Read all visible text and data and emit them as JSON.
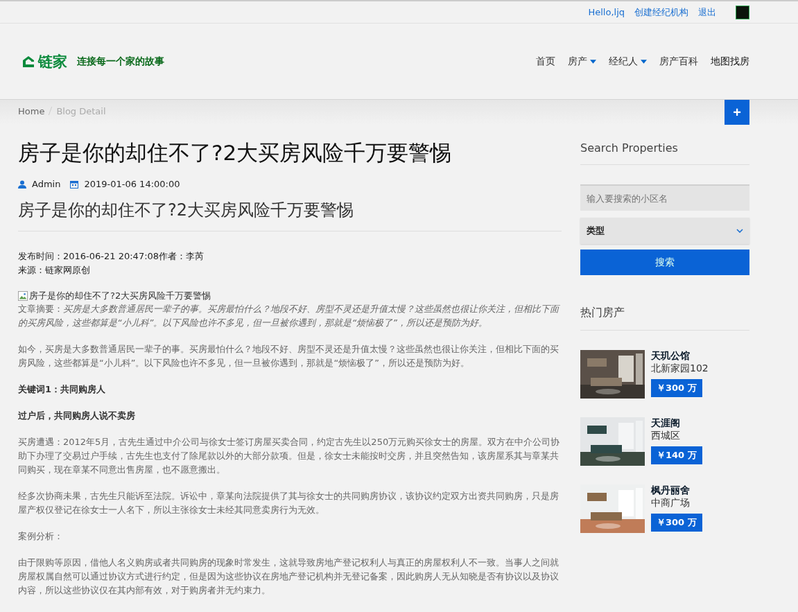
{
  "topbar": {
    "links": [
      "Hello,ljq",
      "创建经纪机构",
      "退出"
    ]
  },
  "header": {
    "logo": "链家",
    "slogan": "连接每一个家的故事",
    "nav": [
      {
        "label": "首页",
        "dropdown": false
      },
      {
        "label": "房产",
        "dropdown": true
      },
      {
        "label": "经纪人",
        "dropdown": true
      },
      {
        "label": "房产百科",
        "dropdown": false
      },
      {
        "label": "地图找房",
        "dropdown": false
      }
    ]
  },
  "breadcrumb": [
    {
      "label": "Home",
      "selected": false
    },
    {
      "label": "Blog Detail",
      "selected": true
    }
  ],
  "add_button": "+",
  "article": {
    "title": "房子是你的却住不了?2大买房风险千万要警惕",
    "author": "Admin",
    "date": "2019-01-06 14:00:00",
    "subtitle": "房子是你的却住不了?2大买房风险千万要警惕",
    "meta": [
      "发布时间：2016-06-21 20:47:08作者：李芮",
      "来源：链家网原创"
    ],
    "image_alt": "房子是你的却住不了?2大买房风险千万要警惕",
    "paragraphs": [
      {
        "kind": "abstract",
        "text": "文章摘要：*买房是大多数普通居民一辈子的事。买房最怕什么？地段不好、房型不灵还是升值太慢？这些虽然也很让你关注，但相比下面的买房风险，这些都算是“小儿科”。以下风险也许不多见，但一旦被你遇到，那就是“烦恼极了”，所以还是预防为好。*"
      },
      {
        "kind": "text",
        "text": "如今，买房是大多数普通居民一辈子的事。买房最怕什么？地段不好、房型不灵还是升值太慢？这些虽然也很让你关注，但相比下面的买房风险，这些都算是“小儿科”。以下风险也许不多见，但一旦被你遇到，那就是“烦恼极了”，所以还是预防为好。"
      },
      {
        "kind": "heading",
        "text": "关键词1：共同购房人"
      },
      {
        "kind": "heading",
        "text": "过户后，共同购房人说不卖房"
      },
      {
        "kind": "text",
        "text": "买房遭遇：2012年5月，古先生通过中介公司与徐女士签订房屋买卖合同，约定古先生以250万元购买徐女士的房屋。双方在中介公司协助下办理了交易过户手续，古先生也支付了除尾款以外的大部分款项。但是，徐女士未能按时交房，并且突然告知，该房屋系其与章某共同购买，现在章某不同意出售房屋，也不愿意搬出。"
      },
      {
        "kind": "text",
        "text": "经多次协商未果，古先生只能诉至法院。诉讼中，章某向法院提供了其与徐女士的共同购房协议，该协议约定双方出资共同购房，只是房屋产权仅登记在徐女士一人名下，所以主张徐女士未经其同意卖房行为无效。"
      },
      {
        "kind": "text",
        "text": "案例分析："
      },
      {
        "kind": "text",
        "text": "由于限购等原因，借他人名义购房或者共同购房的现象时常发生，这就导致房地产登记权利人与真正的房屋权利人不一致。当事人之间就房屋权属自然可以通过协议方式进行约定，但是因为这些协议在房地产登记机构并无登记备案，因此购房人无从知晓是否有协议以及协议内容，所以这些协议仅在其内部有效，对于购房者并无约束力。"
      }
    ]
  },
  "sidebar": {
    "search_title": "Search Properties",
    "search_placeholder": "输入要搜索的小区名",
    "type_select": "类型",
    "search_button": "搜索",
    "hot_title": "热门房产",
    "hot": [
      {
        "name": "天玑公馆",
        "area": "北新家园102",
        "price": "￥300 万",
        "kind": "picture"
      },
      {
        "name": "天涯阁",
        "area": "西城区",
        "price": "￥140 万",
        "kind": "picture"
      },
      {
        "name": "枫丹丽舍",
        "area": "中商广场",
        "price": "￥300 万",
        "kind": "picture"
      }
    ]
  }
}
